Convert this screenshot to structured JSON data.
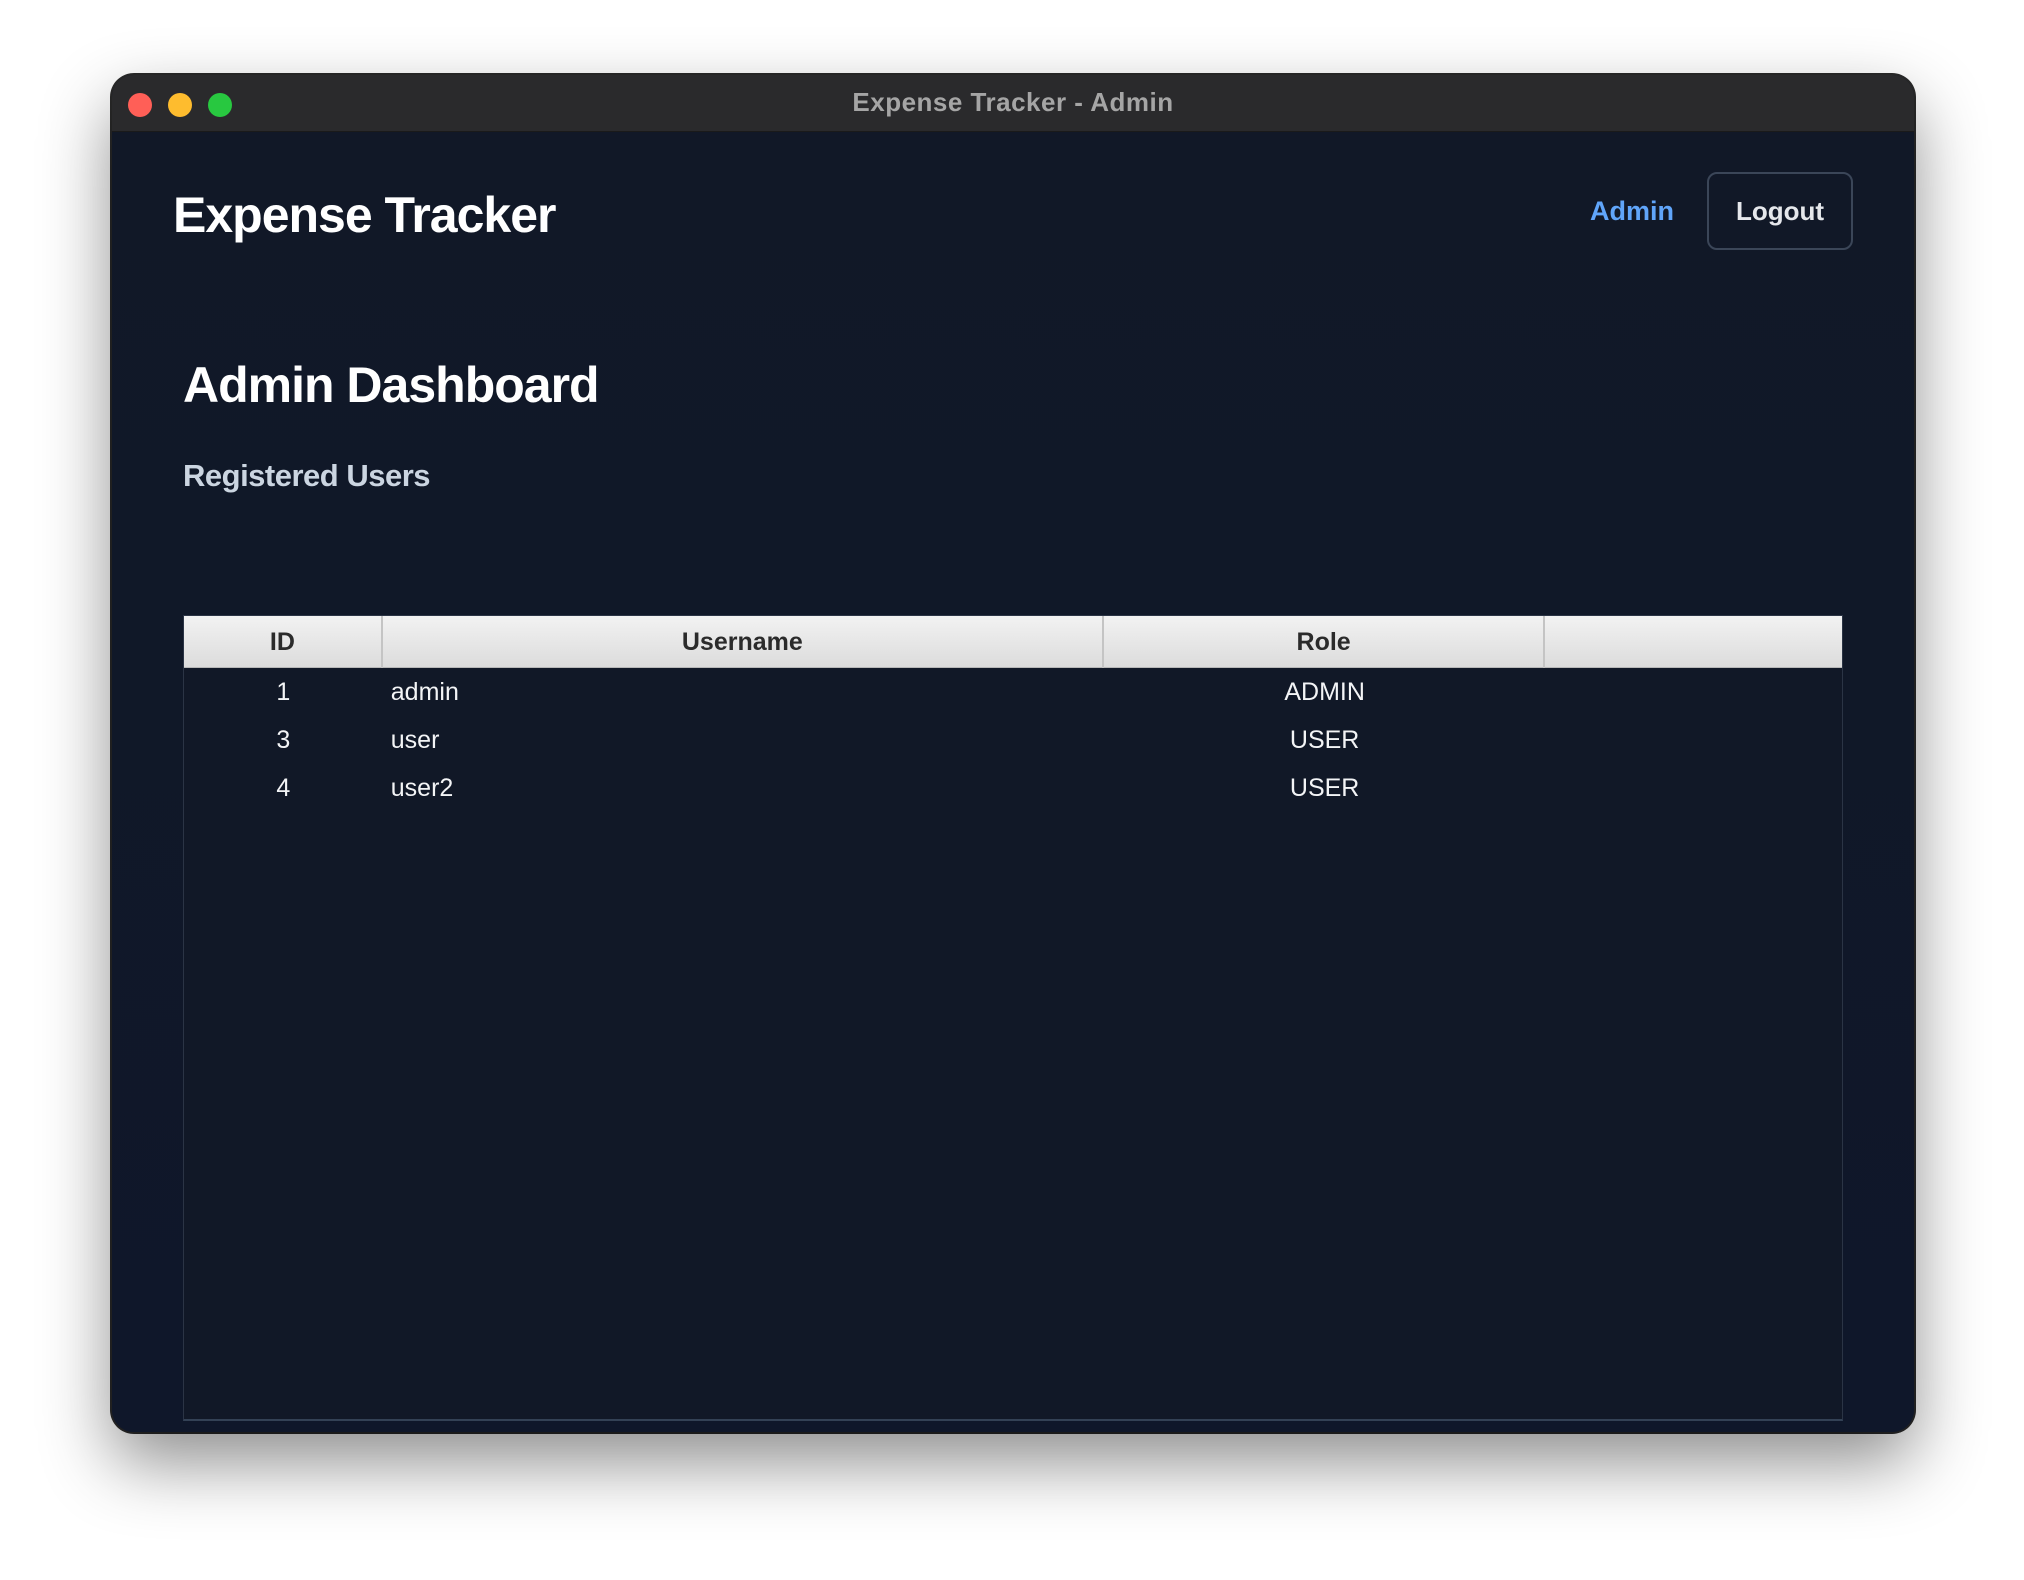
{
  "window": {
    "title": "Expense Tracker - Admin"
  },
  "header": {
    "brand": "Expense Tracker",
    "nav_admin": "Admin",
    "logout_label": "Logout"
  },
  "main": {
    "page_title": "Admin Dashboard",
    "section_title": "Registered Users",
    "table": {
      "columns": [
        "ID",
        "Username",
        "Role",
        ""
      ],
      "rows": [
        {
          "id": "1",
          "username": "admin",
          "role": "ADMIN"
        },
        {
          "id": "3",
          "username": "user",
          "role": "USER"
        },
        {
          "id": "4",
          "username": "user2",
          "role": "USER"
        }
      ]
    }
  },
  "colors": {
    "background": "#0f172a",
    "accent": "#60a5fa",
    "traffic_red": "#ff5f57",
    "traffic_yellow": "#febc2e",
    "traffic_green": "#28c840"
  }
}
